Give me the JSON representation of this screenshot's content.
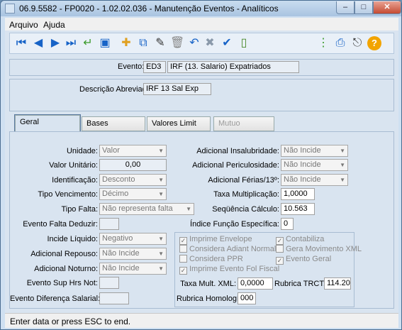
{
  "window": {
    "title": "06.9.5582 - FP0020 - 1.02.02.036 - Manutenção Eventos - Analíticos",
    "min": "–",
    "max": "□",
    "close": "✕"
  },
  "menu": {
    "arquivo": "Arquivo",
    "ajuda": "Ajuda"
  },
  "toolbar": {
    "icons": [
      "first-icon",
      "prev-icon",
      "next-icon",
      "last-icon",
      "return-icon",
      "preview-icon",
      "new-doc-icon",
      "copy-icon",
      "edit-icon",
      "delete-icon",
      "undo-icon",
      "cancel-icon",
      "confirm-icon",
      "blank-doc-icon",
      "tree-icon",
      "print-icon",
      "exit-icon",
      "help-icon"
    ]
  },
  "evento": {
    "label": "Evento:",
    "code": "ED3",
    "desc": "IRF (13. Salario) Expatriados"
  },
  "descricao": {
    "label": "Descrição Abreviada:",
    "value": "IRF 13 Sal Exp"
  },
  "tabs": [
    {
      "label": "Geral",
      "active": true
    },
    {
      "label": "Bases"
    },
    {
      "label": "Valores Limit"
    },
    {
      "label": "Mutuo",
      "disabled": true
    }
  ],
  "geral": {
    "unidade": {
      "label": "Unidade:",
      "value": "Valor"
    },
    "valor_unitario": {
      "label": "Valor Unitário:",
      "value": "0,00"
    },
    "identificacao": {
      "label": "Identificação:",
      "value": "Desconto"
    },
    "tipo_vencimento": {
      "label": "Tipo Vencimento:",
      "value": "Décimo"
    },
    "tipo_falta": {
      "label": "Tipo Falta:",
      "value": "Não representa falta"
    },
    "evento_falta_deduzir": {
      "label": "Evento Falta Deduzir:",
      "value": ""
    },
    "incide_liquido": {
      "label": "Incide Líquido:",
      "value": "Negativo"
    },
    "adicional_repouso": {
      "label": "Adicional Repouso:",
      "value": "Não Incide"
    },
    "adicional_noturno": {
      "label": "Adicional Noturno:",
      "value": "Não Incide"
    },
    "evento_sup_hrs_not": {
      "label": "Evento Sup Hrs Not:",
      "value": ""
    },
    "evento_diferenca_salarial": {
      "label": "Evento Diferença Salarial:",
      "value": ""
    },
    "adicional_insalubridade": {
      "label": "Adicional Insalubridade:",
      "value": "Não Incide"
    },
    "adicional_periculosidade": {
      "label": "Adicional Periculosidade:",
      "value": "Não Incide"
    },
    "adicional_ferias": {
      "label": "Adicional Férias/13º:",
      "value": "Não Incide"
    },
    "taxa_multiplicacao": {
      "label": "Taxa Multiplicação:",
      "value": "1,0000"
    },
    "sequencia_calculo": {
      "label": "Seqüência Cálculo:",
      "value": "10.563"
    },
    "indice_funcao_especifica": {
      "label": "Índice Função Específica:",
      "value": "0"
    },
    "checks": {
      "imprime_envelope": {
        "label": "Imprime Envelope",
        "checked": true
      },
      "contabiliza": {
        "label": "Contabiliza",
        "checked": true
      },
      "considera_adiant_normal": {
        "label": "Considera Adiant Normal",
        "checked": false
      },
      "gera_movimento_xml": {
        "label": "Gera Movimento XML",
        "checked": false
      },
      "considera_ppr": {
        "label": "Considera PPR",
        "checked": false
      },
      "evento_geral": {
        "label": "Evento Geral",
        "checked": true
      },
      "imprime_evento_fol_fiscal": {
        "label": "Imprime Evento Fol Fiscal",
        "checked": true
      }
    },
    "taxa_mult_xml": {
      "label": "Taxa Mult. XML:",
      "value": "0,0000"
    },
    "rubrica_trct": {
      "label": "Rubrica TRCT:",
      "value": "114.20"
    },
    "rubrica_homolognet": {
      "label": "Rubrica HomologNet:",
      "value": "000"
    }
  },
  "status": {
    "text": "Enter data or press ESC to end."
  }
}
